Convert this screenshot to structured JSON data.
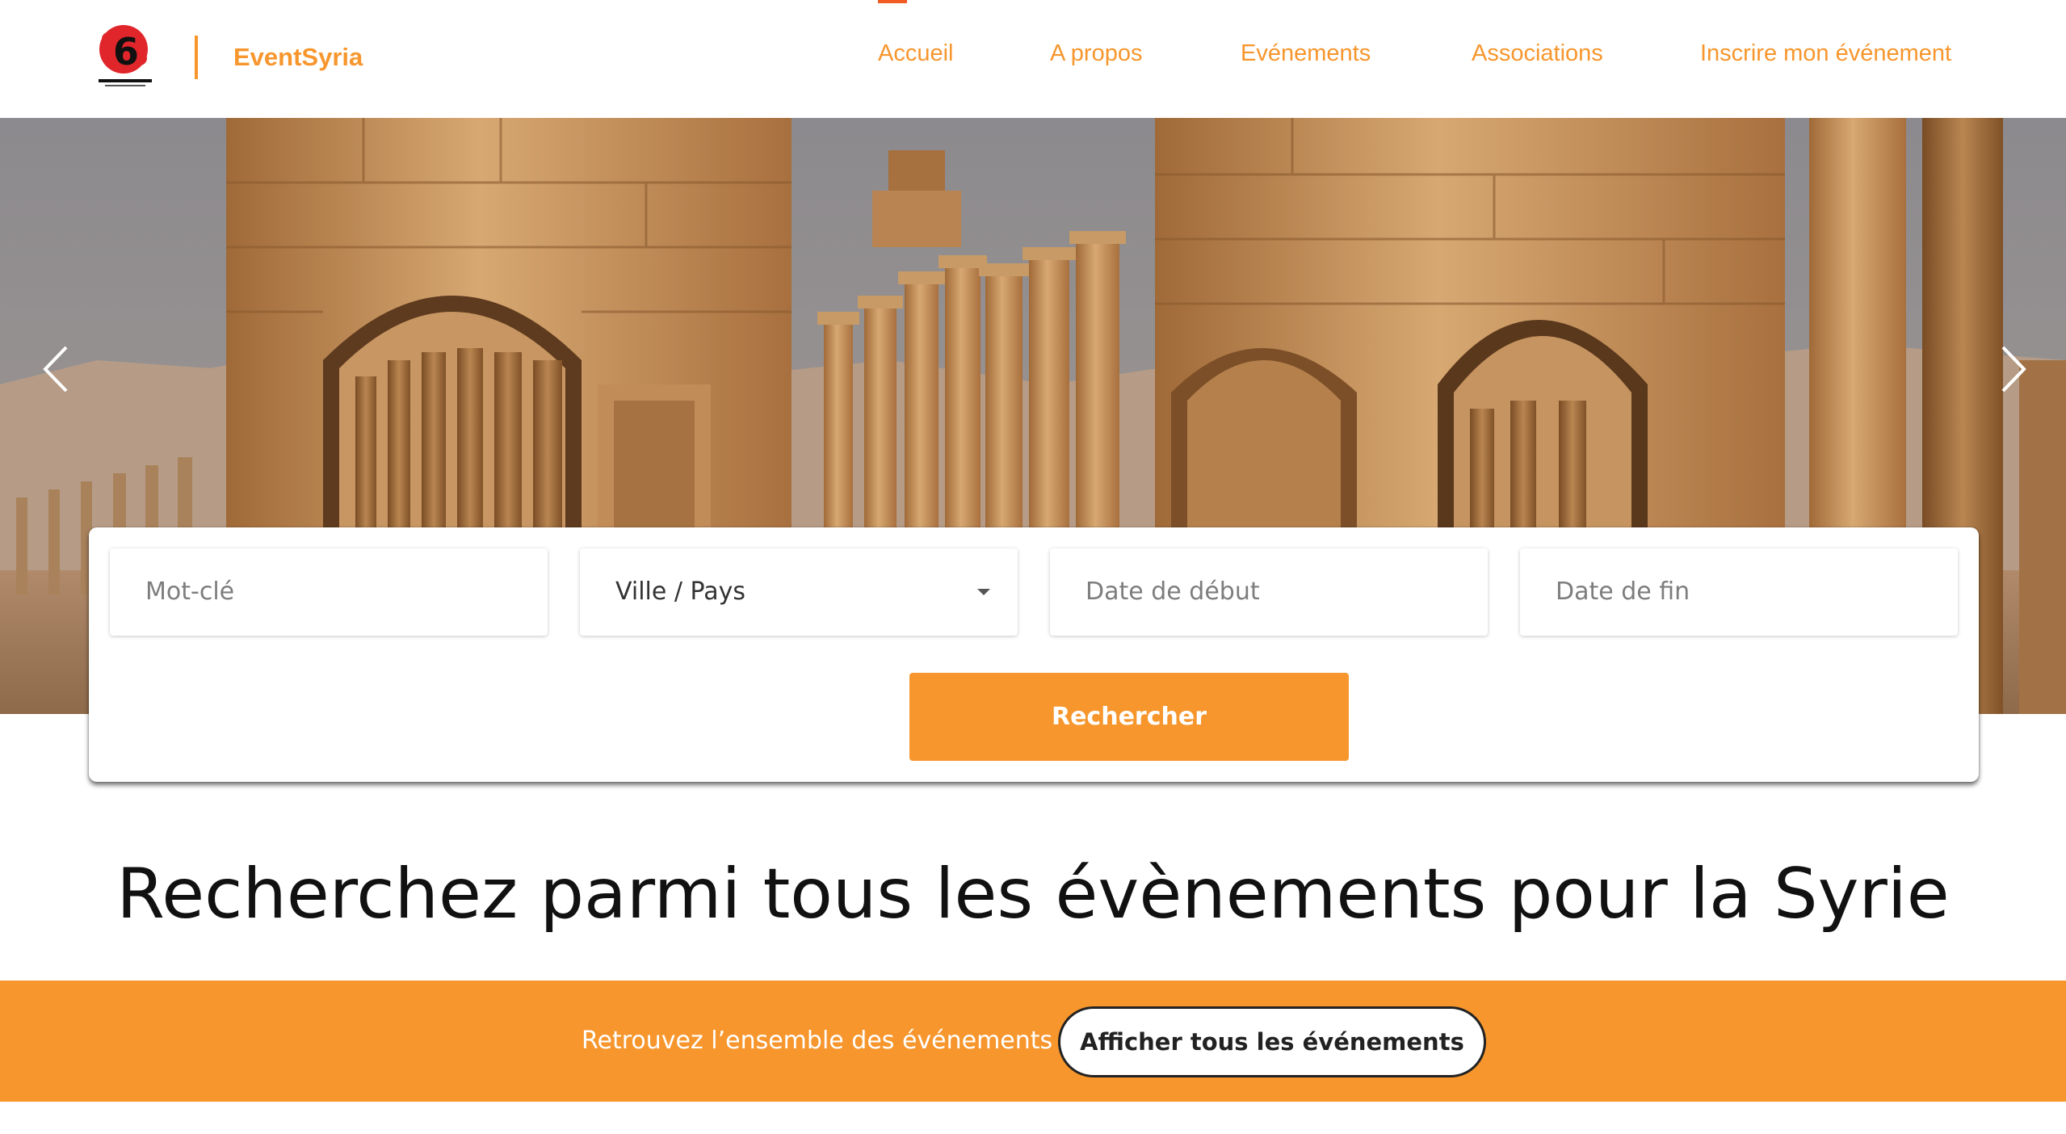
{
  "header": {
    "logo_icon": "revolution-6-logo",
    "brand_name": "EventSyria",
    "nav": [
      {
        "label": "Accueil",
        "active": true
      },
      {
        "label": "A propos",
        "active": false
      },
      {
        "label": "Evénements",
        "active": false
      },
      {
        "label": "Associations",
        "active": false
      },
      {
        "label": "Inscrire mon événement",
        "active": false
      }
    ]
  },
  "hero": {
    "image": "palmyra-ruins-photo",
    "prev_icon": "chevron-left-icon",
    "next_icon": "chevron-right-icon"
  },
  "search": {
    "keyword_placeholder": "Mot-clé",
    "location_value": "Ville / Pays",
    "start_date_placeholder": "Date de début",
    "end_date_placeholder": "Date de fin",
    "button_label": "Rechercher"
  },
  "headline": "Recherchez parmi tous les évènements pour la Syrie",
  "band": {
    "text": "Retrouvez l’ensemble des événements",
    "button_label": "Afficher tous les événements"
  },
  "colors": {
    "accent": "#f7962d",
    "active_marker": "#f15a22",
    "logo_red": "#e0262b"
  }
}
